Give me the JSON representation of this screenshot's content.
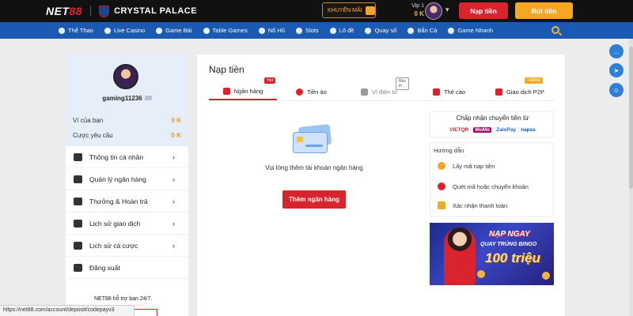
{
  "brand": {
    "logo_prefix": "NET",
    "logo_suffix": "88",
    "partner": "CRYSTAL PALACE"
  },
  "header": {
    "promo_label": "KHUYẾN MÃI",
    "vip_label": "Vip 1",
    "vip_balance": "0 K",
    "deposit_button": "Nạp tiền",
    "withdraw_button": "Rút tiền"
  },
  "nav": {
    "items": [
      {
        "label": "Thể Thao",
        "icon": "sports-icon"
      },
      {
        "label": "Live Casino",
        "icon": "live-casino-icon"
      },
      {
        "label": "Game Bài",
        "icon": "cards-icon"
      },
      {
        "label": "Table Games",
        "icon": "table-games-icon"
      },
      {
        "label": "Nổ Hũ",
        "icon": "slots-jar-icon"
      },
      {
        "label": "Slots",
        "icon": "slots-icon"
      },
      {
        "label": "Lô đề",
        "icon": "lottery-icon"
      },
      {
        "label": "Quay số",
        "icon": "spin-icon"
      },
      {
        "label": "Bắn Cá",
        "icon": "fish-icon"
      },
      {
        "label": "Game Nhanh",
        "icon": "fast-game-icon"
      }
    ]
  },
  "sidebar": {
    "username": "gaming11236",
    "wallet_label": "Ví của bạn",
    "wallet_amount": "0 K",
    "bet_req_label": "Cược yêu cầu",
    "bet_req_amount": "0 K",
    "menu": [
      {
        "label": "Thông tin cá nhân"
      },
      {
        "label": "Quản lý ngân hàng"
      },
      {
        "label": "Thưởng & Hoàn trả"
      },
      {
        "label": "Lịch sử giao dịch"
      },
      {
        "label": "Lịch sử cá cược"
      },
      {
        "label": "Đăng xuất"
      }
    ],
    "support_text": "NET88 hỗ trợ bạn 24/7."
  },
  "main": {
    "title": "Nạp tiền",
    "tabs": [
      {
        "label": "Ngân hàng",
        "badge": "Hot"
      },
      {
        "label": "Tiền ảo"
      },
      {
        "label": "Ví điện tử",
        "badge": "Bảo trì"
      },
      {
        "label": "Thẻ cào"
      },
      {
        "label": "Giao dịch P2P",
        "badge": "+BANK"
      }
    ],
    "empty_text": "Vui lòng thêm tài khoản ngân hàng",
    "add_bank_button": "Thêm ngân hàng",
    "accept_title": "Chấp nhận chuyển tiền từ",
    "bank_logos": [
      "VIETQR",
      "MoMo",
      "ZaloPay",
      "napas"
    ],
    "guide_title": "Hướng dẫn",
    "steps": [
      {
        "label": "Lấy mã nạp tiền"
      },
      {
        "label": "Quét mã hoặc chuyển khoản"
      },
      {
        "label": "Xác nhận thanh toán"
      }
    ],
    "banner": {
      "line1": "NẠP NGAY",
      "line2": "QUAY TRÚNG BINGO",
      "line3": "100 triệu"
    }
  },
  "statusbar": {
    "url": "https://net88.com/account/deposit/codepayv3"
  },
  "colors": {
    "accent_red": "#d9232d",
    "nav_blue": "#1b5ab3",
    "gold": "#f5a623"
  }
}
